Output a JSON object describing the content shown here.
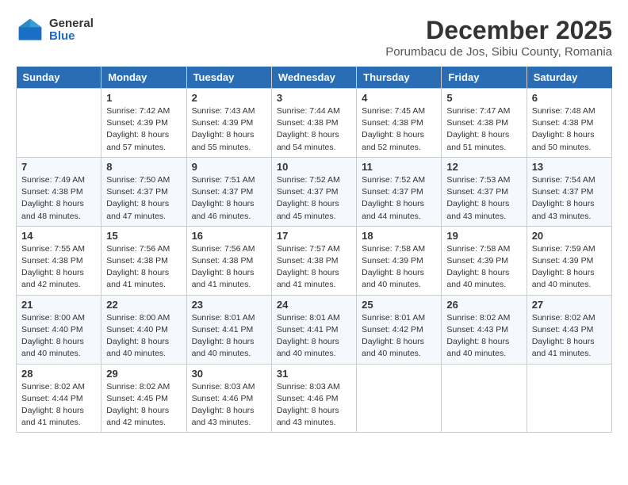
{
  "header": {
    "logo_general": "General",
    "logo_blue": "Blue",
    "title": "December 2025",
    "subtitle": "Porumbacu de Jos, Sibiu County, Romania"
  },
  "weekdays": [
    "Sunday",
    "Monday",
    "Tuesday",
    "Wednesday",
    "Thursday",
    "Friday",
    "Saturday"
  ],
  "weeks": [
    [
      {
        "day": "",
        "info": ""
      },
      {
        "day": "1",
        "info": "Sunrise: 7:42 AM\nSunset: 4:39 PM\nDaylight: 8 hours\nand 57 minutes."
      },
      {
        "day": "2",
        "info": "Sunrise: 7:43 AM\nSunset: 4:39 PM\nDaylight: 8 hours\nand 55 minutes."
      },
      {
        "day": "3",
        "info": "Sunrise: 7:44 AM\nSunset: 4:38 PM\nDaylight: 8 hours\nand 54 minutes."
      },
      {
        "day": "4",
        "info": "Sunrise: 7:45 AM\nSunset: 4:38 PM\nDaylight: 8 hours\nand 52 minutes."
      },
      {
        "day": "5",
        "info": "Sunrise: 7:47 AM\nSunset: 4:38 PM\nDaylight: 8 hours\nand 51 minutes."
      },
      {
        "day": "6",
        "info": "Sunrise: 7:48 AM\nSunset: 4:38 PM\nDaylight: 8 hours\nand 50 minutes."
      }
    ],
    [
      {
        "day": "7",
        "info": "Sunrise: 7:49 AM\nSunset: 4:38 PM\nDaylight: 8 hours\nand 48 minutes."
      },
      {
        "day": "8",
        "info": "Sunrise: 7:50 AM\nSunset: 4:37 PM\nDaylight: 8 hours\nand 47 minutes."
      },
      {
        "day": "9",
        "info": "Sunrise: 7:51 AM\nSunset: 4:37 PM\nDaylight: 8 hours\nand 46 minutes."
      },
      {
        "day": "10",
        "info": "Sunrise: 7:52 AM\nSunset: 4:37 PM\nDaylight: 8 hours\nand 45 minutes."
      },
      {
        "day": "11",
        "info": "Sunrise: 7:52 AM\nSunset: 4:37 PM\nDaylight: 8 hours\nand 44 minutes."
      },
      {
        "day": "12",
        "info": "Sunrise: 7:53 AM\nSunset: 4:37 PM\nDaylight: 8 hours\nand 43 minutes."
      },
      {
        "day": "13",
        "info": "Sunrise: 7:54 AM\nSunset: 4:37 PM\nDaylight: 8 hours\nand 43 minutes."
      }
    ],
    [
      {
        "day": "14",
        "info": "Sunrise: 7:55 AM\nSunset: 4:38 PM\nDaylight: 8 hours\nand 42 minutes."
      },
      {
        "day": "15",
        "info": "Sunrise: 7:56 AM\nSunset: 4:38 PM\nDaylight: 8 hours\nand 41 minutes."
      },
      {
        "day": "16",
        "info": "Sunrise: 7:56 AM\nSunset: 4:38 PM\nDaylight: 8 hours\nand 41 minutes."
      },
      {
        "day": "17",
        "info": "Sunrise: 7:57 AM\nSunset: 4:38 PM\nDaylight: 8 hours\nand 41 minutes."
      },
      {
        "day": "18",
        "info": "Sunrise: 7:58 AM\nSunset: 4:39 PM\nDaylight: 8 hours\nand 40 minutes."
      },
      {
        "day": "19",
        "info": "Sunrise: 7:58 AM\nSunset: 4:39 PM\nDaylight: 8 hours\nand 40 minutes."
      },
      {
        "day": "20",
        "info": "Sunrise: 7:59 AM\nSunset: 4:39 PM\nDaylight: 8 hours\nand 40 minutes."
      }
    ],
    [
      {
        "day": "21",
        "info": "Sunrise: 8:00 AM\nSunset: 4:40 PM\nDaylight: 8 hours\nand 40 minutes."
      },
      {
        "day": "22",
        "info": "Sunrise: 8:00 AM\nSunset: 4:40 PM\nDaylight: 8 hours\nand 40 minutes."
      },
      {
        "day": "23",
        "info": "Sunrise: 8:01 AM\nSunset: 4:41 PM\nDaylight: 8 hours\nand 40 minutes."
      },
      {
        "day": "24",
        "info": "Sunrise: 8:01 AM\nSunset: 4:41 PM\nDaylight: 8 hours\nand 40 minutes."
      },
      {
        "day": "25",
        "info": "Sunrise: 8:01 AM\nSunset: 4:42 PM\nDaylight: 8 hours\nand 40 minutes."
      },
      {
        "day": "26",
        "info": "Sunrise: 8:02 AM\nSunset: 4:43 PM\nDaylight: 8 hours\nand 40 minutes."
      },
      {
        "day": "27",
        "info": "Sunrise: 8:02 AM\nSunset: 4:43 PM\nDaylight: 8 hours\nand 41 minutes."
      }
    ],
    [
      {
        "day": "28",
        "info": "Sunrise: 8:02 AM\nSunset: 4:44 PM\nDaylight: 8 hours\nand 41 minutes."
      },
      {
        "day": "29",
        "info": "Sunrise: 8:02 AM\nSunset: 4:45 PM\nDaylight: 8 hours\nand 42 minutes."
      },
      {
        "day": "30",
        "info": "Sunrise: 8:03 AM\nSunset: 4:46 PM\nDaylight: 8 hours\nand 43 minutes."
      },
      {
        "day": "31",
        "info": "Sunrise: 8:03 AM\nSunset: 4:46 PM\nDaylight: 8 hours\nand 43 minutes."
      },
      {
        "day": "",
        "info": ""
      },
      {
        "day": "",
        "info": ""
      },
      {
        "day": "",
        "info": ""
      }
    ]
  ]
}
